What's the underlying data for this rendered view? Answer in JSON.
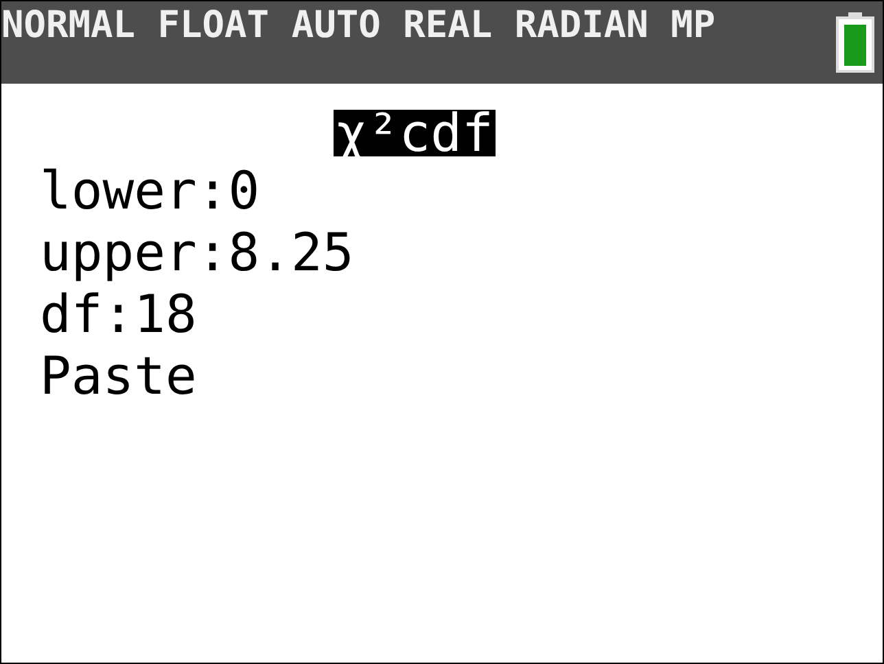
{
  "status_bar": {
    "modes": "NORMAL FLOAT AUTO REAL RADIAN MP"
  },
  "title": "χ²cdf",
  "lines": [
    "lower:0",
    "upper:8.25",
    "df:18",
    "Paste"
  ]
}
